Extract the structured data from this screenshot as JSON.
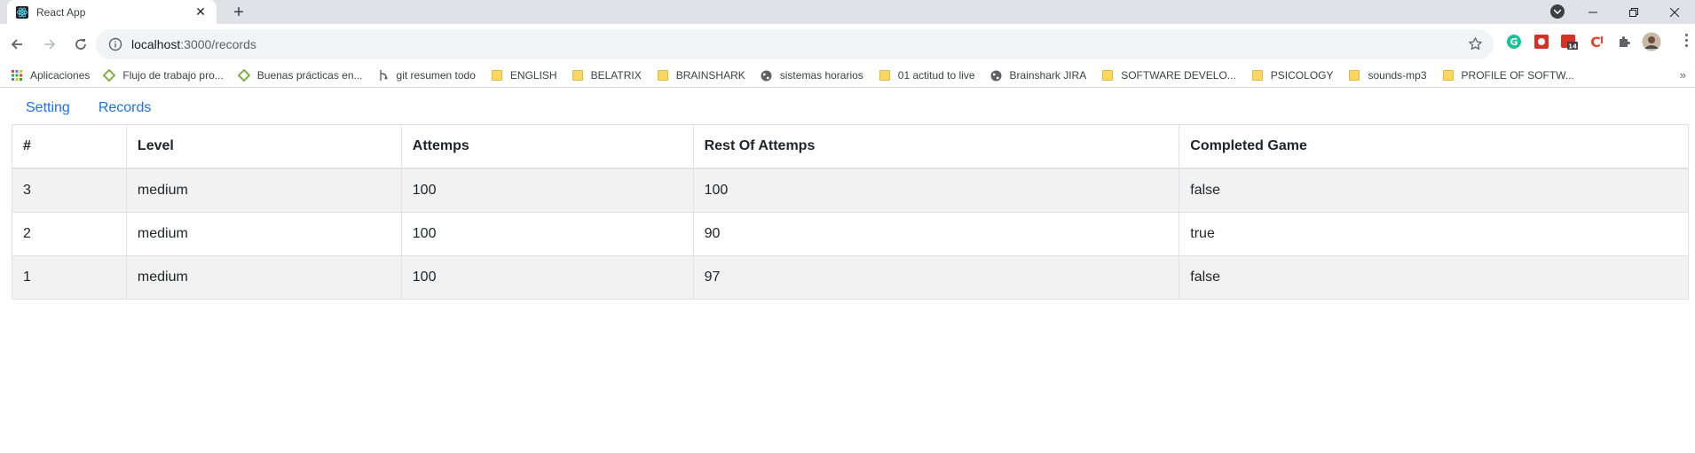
{
  "browser": {
    "tab_title": "React App",
    "url_host": "localhost",
    "url_rest": ":3000/records",
    "bookmarks": [
      {
        "label": "Aplicaciones",
        "icon": "apps-grid-icon"
      },
      {
        "label": "Flujo de trabajo pro...",
        "icon": "diamond-icon"
      },
      {
        "label": "Buenas prácticas en...",
        "icon": "diamond-icon"
      },
      {
        "label": "git resumen todo",
        "icon": "git-icon"
      },
      {
        "label": "ENGLISH",
        "icon": "folder-icon"
      },
      {
        "label": "BELATRIX",
        "icon": "folder-icon"
      },
      {
        "label": "BRAINSHARK",
        "icon": "folder-icon"
      },
      {
        "label": "sistemas horarios",
        "icon": "globe-icon"
      },
      {
        "label": "01 actitud to live",
        "icon": "folder-icon"
      },
      {
        "label": "Brainshark JIRA",
        "icon": "globe-icon"
      },
      {
        "label": "SOFTWARE DEVELO...",
        "icon": "folder-icon"
      },
      {
        "label": "PSICOLOGY",
        "icon": "folder-icon"
      },
      {
        "label": "sounds-mp3",
        "icon": "folder-icon"
      },
      {
        "label": "PROFILE OF SOFTW...",
        "icon": "folder-icon"
      }
    ],
    "extension_badge": "14",
    "accent_colors": {
      "link": "#1a73e8",
      "grammarly": "#15c39a",
      "ext_red": "#d93025"
    }
  },
  "nav": {
    "setting_label": "Setting",
    "records_label": "Records"
  },
  "table": {
    "headers": [
      "#",
      "Level",
      "Attemps",
      "Rest Of Attemps",
      "Completed Game"
    ],
    "rows": [
      [
        "3",
        "medium",
        "100",
        "100",
        "false"
      ],
      [
        "2",
        "medium",
        "100",
        "90",
        "true"
      ],
      [
        "1",
        "medium",
        "100",
        "97",
        "false"
      ]
    ]
  }
}
